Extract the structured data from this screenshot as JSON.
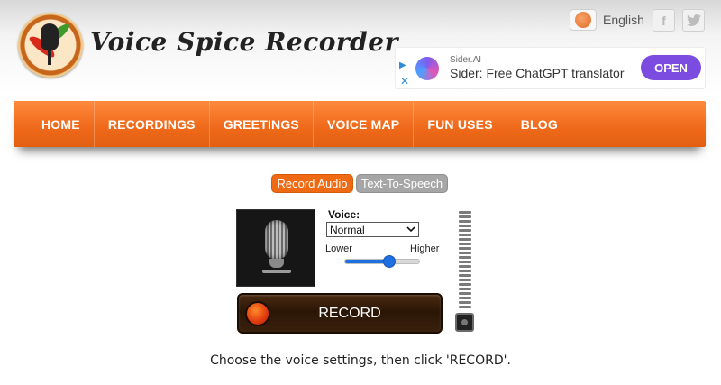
{
  "brand": {
    "name": "Voice Spice Recorder"
  },
  "language": {
    "label": "English"
  },
  "social": [
    {
      "name": "facebook",
      "glyph": "f"
    },
    {
      "name": "twitter",
      "glyph": "t"
    }
  ],
  "ad": {
    "brand": "Sider.AI",
    "title": "Sider: Free ChatGPT translator",
    "cta": "OPEN"
  },
  "nav": {
    "items": [
      {
        "label": "HOME"
      },
      {
        "label": "RECORDINGS"
      },
      {
        "label": "GREETINGS"
      },
      {
        "label": "VOICE MAP"
      },
      {
        "label": "FUN USES"
      },
      {
        "label": "BLOG"
      }
    ]
  },
  "tabs": {
    "record": "Record Audio",
    "tts": "Text-To-Speech",
    "active": "record"
  },
  "voice": {
    "label": "Voice:",
    "selected": "Normal",
    "lower": "Lower",
    "higher": "Higher",
    "pitch_fraction": 0.6
  },
  "meter": {
    "segments": 22,
    "level": 0
  },
  "record": {
    "label": "RECORD"
  },
  "instructions": "Choose the voice settings, then click 'RECORD'.",
  "colors": {
    "accent": "#ef6a12",
    "nav": "#f06b1b",
    "slider": "#1f6fe0",
    "ad_cta": "#7c4ce0"
  },
  "icons": {
    "logo": "chili-microphone-logo",
    "language": "globe-icon",
    "mic": "microphone-icon",
    "record": "record-dot-icon",
    "meter": "level-meter-icon"
  }
}
